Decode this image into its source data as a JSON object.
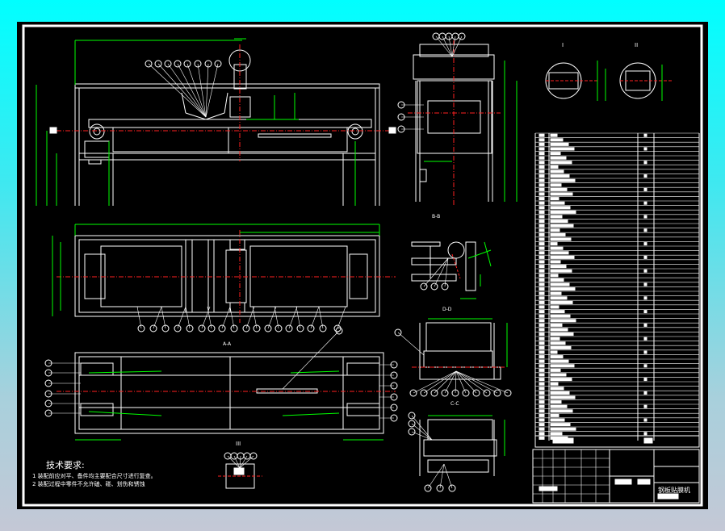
{
  "drawing": {
    "title": "钢板贴膜机",
    "view_labels": {
      "section_bb": "B-B",
      "section_dd": "D-D",
      "section_cc": "C-C",
      "section_aa": "A-A",
      "detail_1": "I",
      "detail_2": "II",
      "detail_3": "III"
    },
    "notes": {
      "heading": "技术要求:",
      "items": [
        "1  装配前应对平、备件均主要配合尺寸进行复查。",
        "2  装配过程中零件不允许磕、碰、划伤和锈蚀"
      ]
    },
    "colors": {
      "background": "#000000",
      "outline": "#ffffff",
      "dimension": "#00ff00",
      "centerline": "#ff2020",
      "window_gradient_top": "#00ffff",
      "window_gradient_bottom": "#c4c8d6"
    }
  }
}
